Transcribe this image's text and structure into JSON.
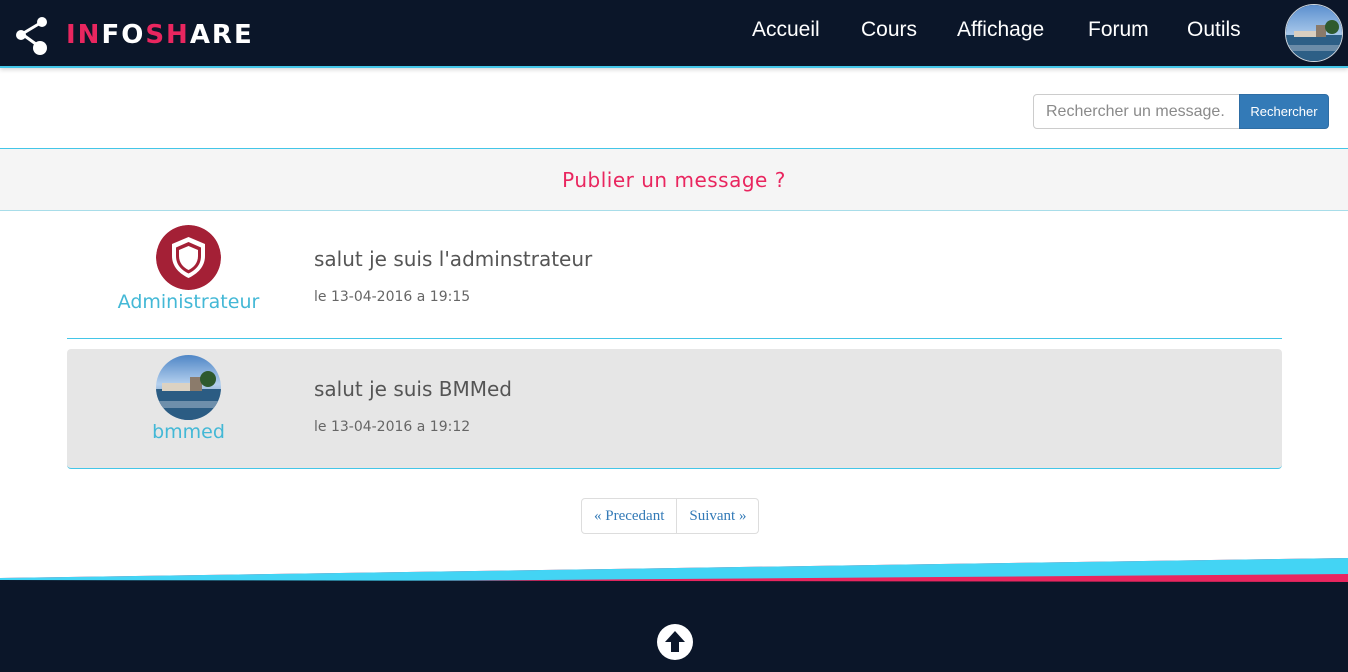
{
  "brand": {
    "prefix": "IN",
    "middle": "FO",
    "sh": "SH",
    "suffix": "ARE",
    "colors": {
      "pink": "#e9265f",
      "blue": "#43c6e8",
      "navy": "#0b1629"
    }
  },
  "nav": {
    "items": [
      {
        "label": "Accueil"
      },
      {
        "label": "Cours"
      },
      {
        "label": "Affichage"
      },
      {
        "label": "Forum"
      },
      {
        "label": "Outils"
      }
    ],
    "avatar_icon": "user-photo-avatar"
  },
  "search": {
    "placeholder": "Rechercher un message.",
    "button_label": "Rechercher"
  },
  "publish": {
    "label": "Publier un message ?"
  },
  "messages": [
    {
      "author": "Administrateur",
      "avatar_icon": "shield-icon",
      "text": "salut je suis l'adminstrateur",
      "date": "le 13-04-2016 a 19:15"
    },
    {
      "author": "bmmed",
      "avatar_icon": "user-photo-avatar",
      "text": "salut je suis BMMed",
      "date": "le 13-04-2016 a 19:12"
    }
  ],
  "pagination": {
    "prev_label": "« Precedant",
    "next_label": "Suivant »"
  },
  "footer": {
    "top_icon": "arrow-up-icon"
  }
}
